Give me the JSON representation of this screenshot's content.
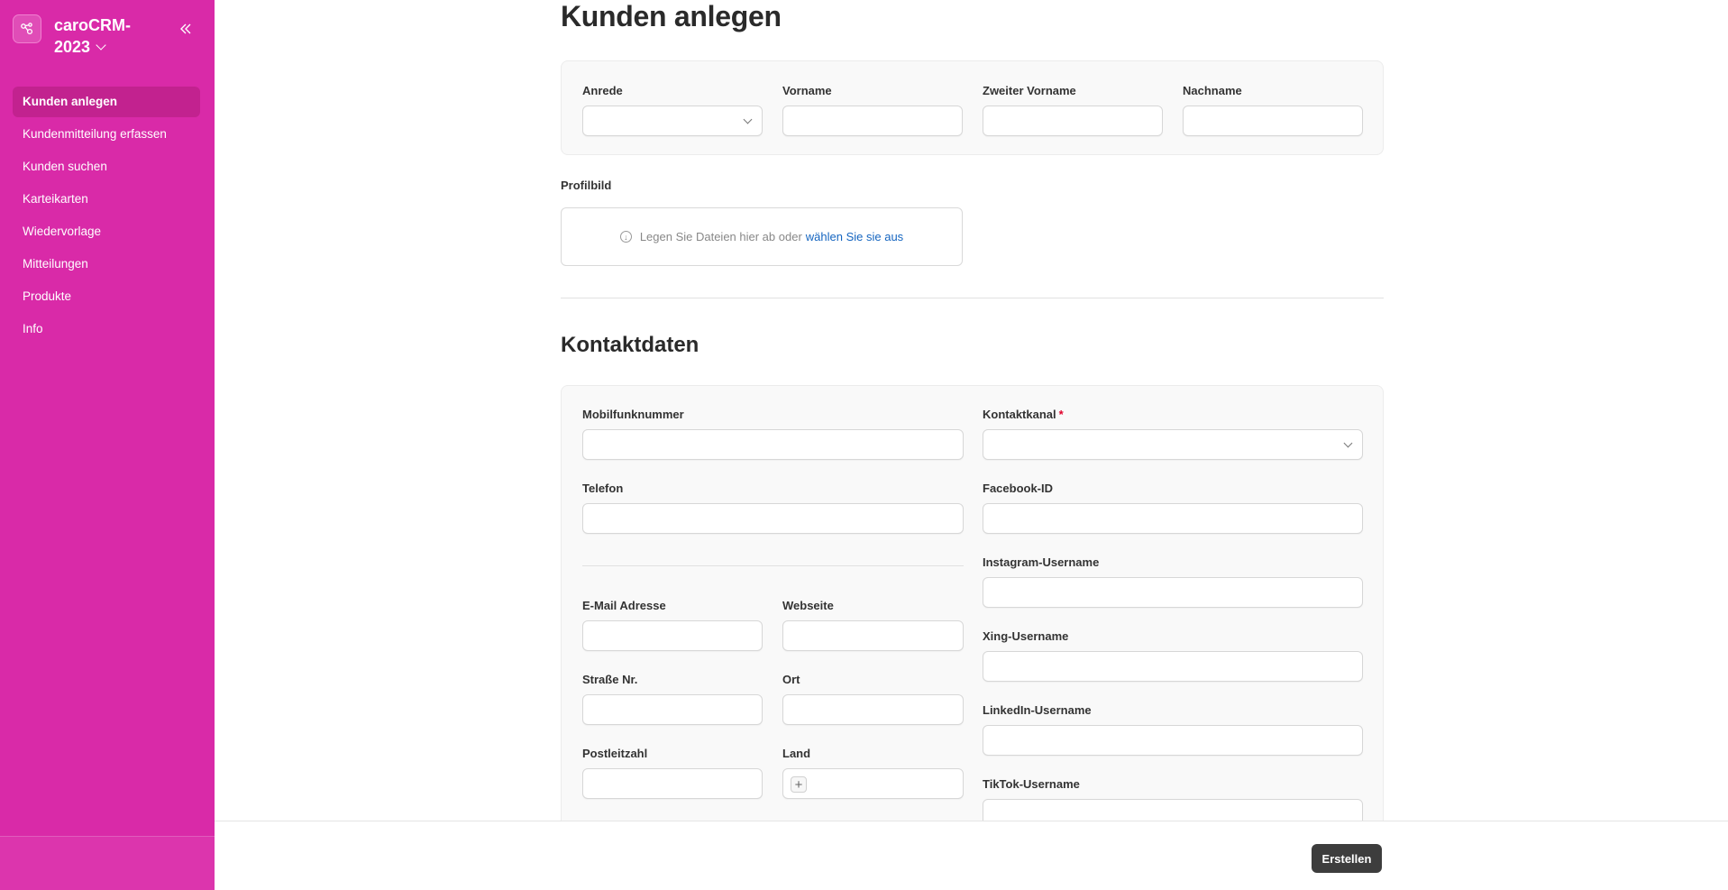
{
  "app": {
    "title": "caroCRM-2023"
  },
  "sidebar": {
    "items": [
      {
        "label": "Kunden anlegen"
      },
      {
        "label": "Kundenmitteilung erfassen"
      },
      {
        "label": "Kunden suchen"
      },
      {
        "label": "Karteikarten"
      },
      {
        "label": "Wiedervorlage"
      },
      {
        "label": "Mitteilungen"
      },
      {
        "label": "Produkte"
      },
      {
        "label": "Info"
      }
    ]
  },
  "page": {
    "title": "Kunden anlegen"
  },
  "personal": {
    "anrede_label": "Anrede",
    "vorname_label": "Vorname",
    "zweiter_vorname_label": "Zweiter Vorname",
    "nachname_label": "Nachname"
  },
  "profilbild": {
    "label": "Profilbild",
    "drop_text": "Legen Sie Dateien hier ab oder",
    "link_text": "wählen Sie sie aus"
  },
  "kontakt": {
    "title": "Kontaktdaten",
    "mobil_label": "Mobilfunknummer",
    "kontaktkanal_label": "Kontaktkanal",
    "required_mark": "*",
    "telefon_label": "Telefon",
    "facebook_label": "Facebook-ID",
    "instagram_label": "Instagram-Username",
    "email_label": "E-Mail Adresse",
    "webseite_label": "Webseite",
    "xing_label": "Xing-Username",
    "strasse_label": "Straße Nr.",
    "ort_label": "Ort",
    "linkedin_label": "LinkedIn-Username",
    "plz_label": "Postleitzahl",
    "land_label": "Land",
    "tiktok_label": "TikTok-Username"
  },
  "actions": {
    "create_label": "Erstellen"
  },
  "colors": {
    "sidebar": "#d92aa8",
    "sidebar_active": "#c2228f",
    "primary_button": "#3d3d3d",
    "link": "#1565c0"
  }
}
